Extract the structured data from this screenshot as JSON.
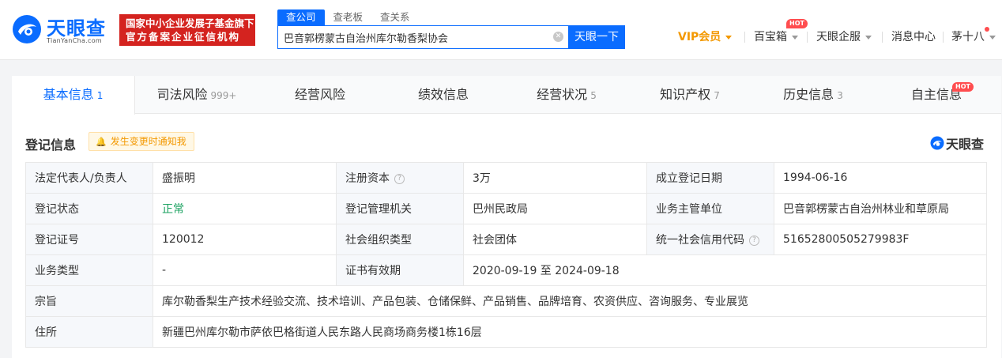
{
  "header": {
    "logo_text": "天眼查",
    "logo_sub": "TianYanCha.com",
    "badge_line1": "国家中小企业发展子基金旗下",
    "badge_line2": "官方备案企业征信机构",
    "search_tabs": [
      "查公司",
      "查老板",
      "查关系"
    ],
    "search_value": "巴音郭楞蒙古自治州库尔勒香梨协会",
    "search_button": "天眼一下",
    "nav": {
      "vip": "VIP会员",
      "treasure": "百宝箱",
      "enterprise": "天眼企服",
      "messages": "消息中心",
      "user": "茅十八"
    },
    "hot_label": "HOT"
  },
  "tabs": [
    {
      "label": "基本信息",
      "count": "1"
    },
    {
      "label": "司法风险",
      "count": "999+"
    },
    {
      "label": "经营风险",
      "count": ""
    },
    {
      "label": "绩效信息",
      "count": ""
    },
    {
      "label": "经营状况",
      "count": "5"
    },
    {
      "label": "知识产权",
      "count": "7"
    },
    {
      "label": "历史信息",
      "count": "3"
    },
    {
      "label": "自主信息",
      "count": ""
    }
  ],
  "section": {
    "title": "登记信息",
    "notify": "发生变更时通知我",
    "brand": "天眼查"
  },
  "info": {
    "legal_rep_label": "法定代表人/负责人",
    "legal_rep": "盛振明",
    "reg_capital_label": "注册资本",
    "reg_capital": "3万",
    "found_date_label": "成立登记日期",
    "found_date": "1994-06-16",
    "status_label": "登记状态",
    "status": "正常",
    "authority_label": "登记管理机关",
    "authority": "巴州民政局",
    "supervisor_label": "业务主管单位",
    "supervisor": "巴音郭楞蒙古自治州林业和草原局",
    "cert_no_label": "登记证号",
    "cert_no": "120012",
    "org_type_label": "社会组织类型",
    "org_type": "社会团体",
    "credit_code_label": "统一社会信用代码",
    "credit_code": "51652800505279983F",
    "biz_type_label": "业务类型",
    "biz_type": "-",
    "validity_label": "证书有效期",
    "validity": "2020-09-19 至 2024-09-18",
    "purpose_label": "宗旨",
    "purpose": "库尔勒香梨生产技术经验交流、技术培训、产品包装、仓储保鲜、产品销售、品牌培育、农资供应、咨询服务、专业展览",
    "address_label": "住所",
    "address": "新疆巴州库尔勒市萨依巴格街道人民东路人民商场商务楼1栋16层"
  },
  "colors": {
    "accent": "#0a6cff",
    "vip": "#f39800",
    "badge": "#d4231f",
    "status_ok": "#19a15f"
  }
}
